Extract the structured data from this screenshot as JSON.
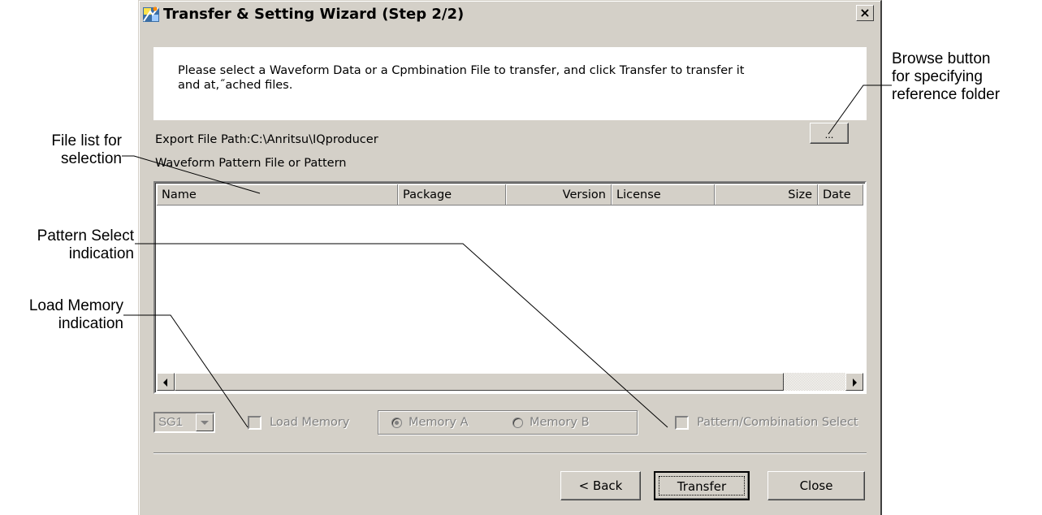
{
  "window": {
    "title": "Transfer & Setting Wizard (Step 2/2)",
    "close_label": "×"
  },
  "message": "Please select a Waveform Data or a Cpmbination File to transfer, and click Transfer to transfer it and at,˝ached files.",
  "export_path": "Export File Path:C:\\Anritsu\\IQproducer",
  "browse_label": "...",
  "list_label": "Waveform Pattern File or Pattern",
  "file_list": {
    "columns": [
      "Name",
      "Package",
      "Version",
      "License",
      "Size",
      "Date"
    ],
    "rows": []
  },
  "sg_select": {
    "value": "SG1"
  },
  "load_memory": {
    "label": "Load Memory",
    "checked": false
  },
  "memory_group": {
    "options": [
      "Memory A",
      "Memory B"
    ],
    "selected": "Memory A"
  },
  "pattern_select": {
    "label": "Pattern/Combination Select",
    "checked": false
  },
  "buttons": {
    "back": "< Back",
    "transfer": "Transfer",
    "close": "Close"
  },
  "annotations": {
    "browse": "Browse button\nfor specifying\nreference folder",
    "file_list": "File  list  for\nselection",
    "pattern_select": "Pattern Select\nindication",
    "load_memory": "Load Memory\nindication"
  },
  "colors": {
    "dialog_bg": "#d4d0c8",
    "disabled_text": "#808080"
  },
  "icons": [
    "wizard-app-icon",
    "close-icon",
    "scroll-left-icon",
    "scroll-right-icon",
    "dropdown-arrow-icon"
  ]
}
